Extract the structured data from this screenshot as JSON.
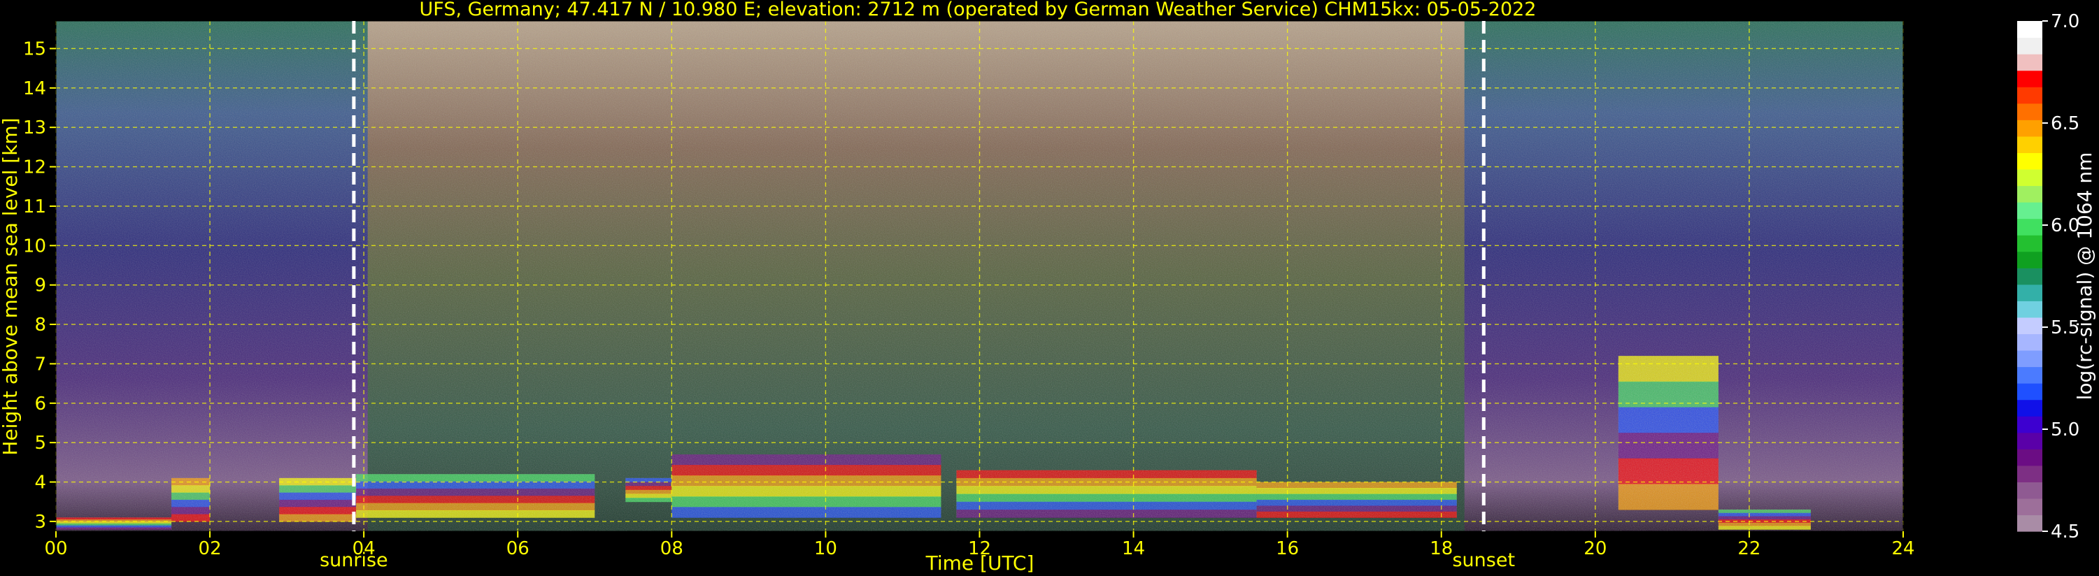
{
  "chart_data": {
    "type": "heatmap",
    "title": "UFS, Germany; 47.417 N / 10.980 E; elevation: 2712 m  (operated by German Weather Service)    CHM15kx: 05-05-2022",
    "xlabel": "Time [UTC]",
    "ylabel": "Height above mean sea level [km]",
    "xlim": [
      0,
      24
    ],
    "ylim": [
      2.75,
      15.7
    ],
    "x_ticks": [
      "00",
      "02",
      "04",
      "06",
      "08",
      "10",
      "12",
      "14",
      "16",
      "18",
      "20",
      "22",
      "24"
    ],
    "y_ticks": [
      "3",
      "4",
      "5",
      "6",
      "7",
      "8",
      "9",
      "10",
      "11",
      "12",
      "13",
      "14",
      "15"
    ],
    "grid": true,
    "colorbar": {
      "label": "log(rc-signal) @ 1064 nm",
      "range": [
        4.5,
        7.0
      ],
      "ticks": [
        "4.5",
        "5.0",
        "5.5",
        "6.0",
        "6.5",
        "7.0"
      ],
      "colors": [
        "#a98ca6",
        "#9d6f9a",
        "#8f5a92",
        "#7d2f84",
        "#6b0d84",
        "#5a00a8",
        "#3d00d0",
        "#1010e8",
        "#1f50ff",
        "#4b7bff",
        "#7f9dff",
        "#a7b6ff",
        "#c4ccff",
        "#70d0e0",
        "#33b0a8",
        "#1a9060",
        "#0fa020",
        "#23c030",
        "#40e060",
        "#66f090",
        "#a0f060",
        "#d0ff30",
        "#ffff00",
        "#ffd000",
        "#ffa000",
        "#ff7000",
        "#ff3a00",
        "#ff0000",
        "#f0c0c0",
        "#f0f0f0",
        "#ffffff"
      ]
    },
    "annotations": [
      {
        "text": "sunrise",
        "x": 3.87
      },
      {
        "text": "sunset",
        "x": 18.55
      }
    ],
    "features": {
      "cloud_base_km": [
        {
          "t0": 0.0,
          "t1": 1.5,
          "bottom": 2.8,
          "top": 3.1
        },
        {
          "t0": 1.5,
          "t1": 2.0,
          "bottom": 3.0,
          "top": 4.1
        },
        {
          "t0": 2.9,
          "t1": 3.9,
          "bottom": 3.0,
          "top": 4.1
        },
        {
          "t0": 3.9,
          "t1": 7.0,
          "bottom": 3.1,
          "top": 4.2
        },
        {
          "t0": 7.4,
          "t1": 8.0,
          "bottom": 3.5,
          "top": 4.1
        },
        {
          "t0": 8.0,
          "t1": 11.5,
          "bottom": 3.1,
          "top": 4.7
        },
        {
          "t0": 11.7,
          "t1": 15.6,
          "bottom": 3.1,
          "top": 4.3
        },
        {
          "t0": 15.6,
          "t1": 18.2,
          "bottom": 3.1,
          "top": 4.0
        },
        {
          "t0": 20.3,
          "t1": 21.6,
          "bottom": 3.3,
          "top": 7.2
        },
        {
          "t0": 21.6,
          "t1": 22.8,
          "bottom": 2.8,
          "top": 3.3
        }
      ]
    }
  }
}
